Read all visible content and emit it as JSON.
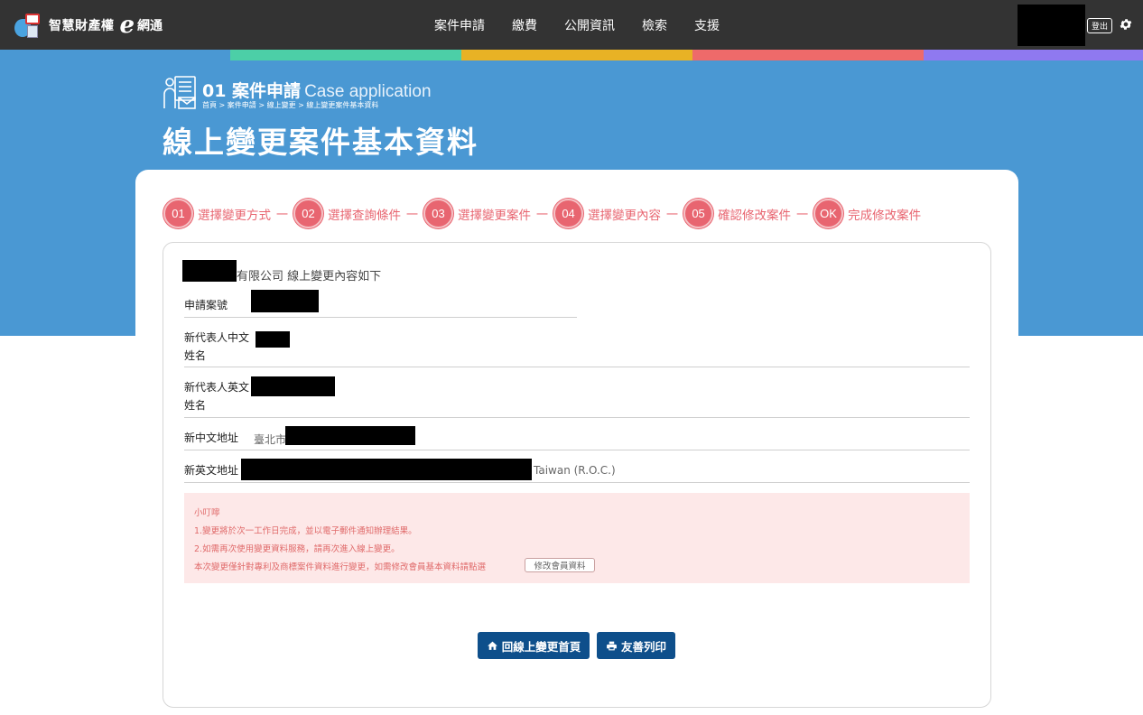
{
  "app": {
    "logo_text": "智慧財產權",
    "logo_e": "e",
    "logo_text2": "網通"
  },
  "nav": {
    "items": [
      {
        "label": "案件申請"
      },
      {
        "label": "繳費"
      },
      {
        "label": "公開資訊"
      },
      {
        "label": "檢索"
      },
      {
        "label": "支援"
      }
    ],
    "logout_label": "登出"
  },
  "colors": {
    "strip": [
      "#4ccfa7",
      "#e8b225",
      "#ee6a6a",
      "#8f79f0"
    ],
    "hero_bg": "#4a98d3",
    "step_accent": "#e86570",
    "button_bg": "#0e4f8b"
  },
  "header": {
    "section_num_title": "01 案件申請",
    "section_en": "Case application",
    "breadcrumb": "首頁 > 案件申請 > 線上變更 > 線上變更案件基本資料",
    "page_title": "線上變更案件基本資料"
  },
  "steps": [
    {
      "num": "01",
      "label": "選擇變更方式"
    },
    {
      "num": "02",
      "label": "選擇查詢條件"
    },
    {
      "num": "03",
      "label": "選擇變更案件"
    },
    {
      "num": "04",
      "label": "選擇變更內容"
    },
    {
      "num": "05",
      "label": "確認修改案件"
    },
    {
      "num": "OK",
      "label": "完成修改案件"
    }
  ],
  "step_separator": "一",
  "content": {
    "company_suffix": "有限公司 線上變更內容如下",
    "fields": {
      "case_no_label": "申請案號",
      "rep_cn_label_1": "新代表人中文",
      "rep_cn_label_2": "姓名",
      "rep_en_label_1": "新代表人英文",
      "rep_en_label_2": "姓名",
      "addr_cn_label": "新中文地址",
      "addr_cn_value": "臺北市",
      "addr_en_label": "新英文地址",
      "addr_en_value": "Taiwan (R.O.C.)"
    }
  },
  "notice": {
    "title": "小叮嚀",
    "line1": "1.變更將於次一工作日完成，並以電子郵件通知辦理結果。",
    "line2": "2.如需再次使用變更資料服務，請再次進入線上變更。",
    "line3": "本次變更僅針對專利及商標案件資料進行變更，如需修改會員基本資料請點選",
    "edit_button": "修改會員資料"
  },
  "buttons": {
    "home_label": "回線上變更首頁",
    "print_label": "友善列印"
  }
}
